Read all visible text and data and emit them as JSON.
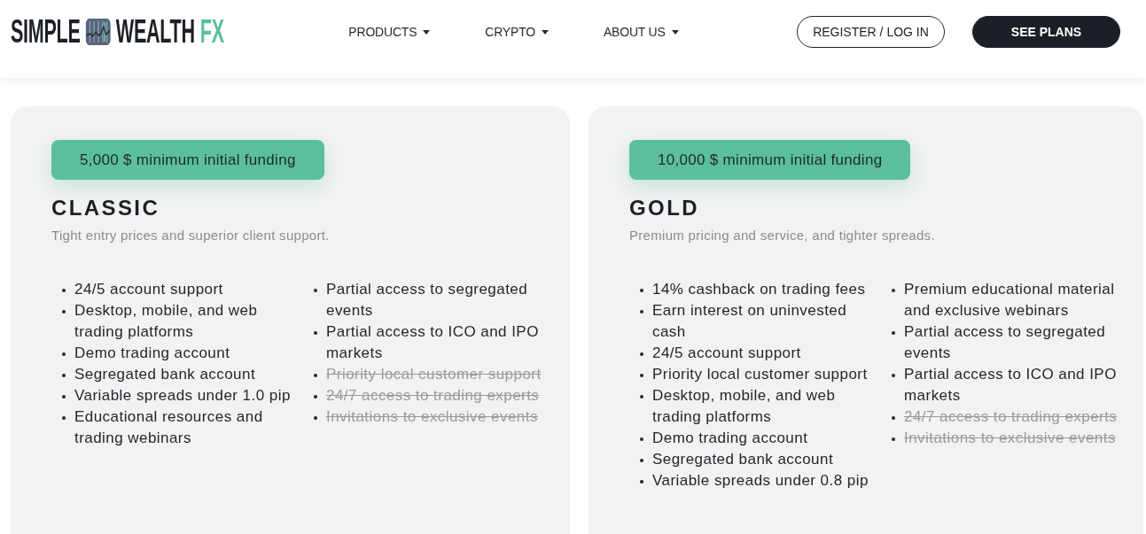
{
  "header": {
    "logo": {
      "words": [
        "SIMPLE",
        "WEALTH"
      ],
      "accent": "FX"
    },
    "nav": [
      {
        "label": "PRODUCTS",
        "dropdown": true
      },
      {
        "label": "CRYPTO",
        "dropdown": true
      },
      {
        "label": "ABOUT US",
        "dropdown": true
      }
    ],
    "actions": [
      {
        "label": "REGISTER / LOG IN",
        "kind": "outline"
      },
      {
        "label": "SEE PLANS",
        "kind": "solid"
      }
    ]
  },
  "plans": [
    {
      "funding": "5,000 $ minimum initial funding",
      "name": "CLASSIC",
      "tagline": "Tight entry prices and superior client support.",
      "feature_columns": [
        [
          {
            "text": "24/5 account support",
            "included": true
          },
          {
            "text": "Desktop, mobile, and web trading platforms",
            "included": true
          },
          {
            "text": "Demo trading account",
            "included": true
          },
          {
            "text": "Segregated bank account",
            "included": true
          },
          {
            "text": "Variable spreads under 1.0 pip",
            "included": true
          },
          {
            "text": "Educational resources and trading webinars",
            "included": true
          }
        ],
        [
          {
            "text": "Partial access to segregated events",
            "included": true
          },
          {
            "text": "Partial access to ICO and IPO markets",
            "included": true
          },
          {
            "text": "Priority local customer support",
            "included": false
          },
          {
            "text": "24/7 access to trading experts",
            "included": false
          },
          {
            "text": "Invitations to exclusive events",
            "included": false
          }
        ]
      ]
    },
    {
      "funding": "10,000 $ minimum initial funding",
      "name": "GOLD",
      "tagline": "Premium pricing and service, and tighter spreads.",
      "feature_columns": [
        [
          {
            "text": "14% cashback on trading fees",
            "included": true
          },
          {
            "text": "Earn interest on uninvested cash",
            "included": true
          },
          {
            "text": "24/5 account support",
            "included": true
          },
          {
            "text": "Priority local customer support",
            "included": true
          },
          {
            "text": "Desktop, mobile, and web trading platforms",
            "included": true
          },
          {
            "text": "Demo trading account",
            "included": true
          },
          {
            "text": "Segregated bank account",
            "included": true
          },
          {
            "text": "Variable spreads under 0.8 pip",
            "included": true
          }
        ],
        [
          {
            "text": "Premium educational material and exclusive webinars",
            "included": true
          },
          {
            "text": "Partial access to segregated events",
            "included": true
          },
          {
            "text": "Partial access to ICO and IPO markets",
            "included": true
          },
          {
            "text": "24/7 access to trading experts",
            "included": false
          },
          {
            "text": "Invitations to exclusive events",
            "included": false
          }
        ]
      ]
    }
  ]
}
